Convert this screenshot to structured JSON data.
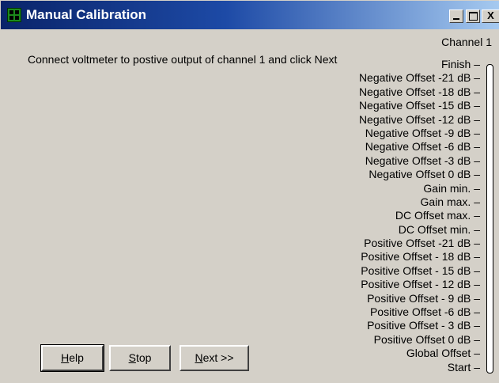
{
  "window": {
    "title": "Manual Calibration",
    "minimize_icon": "minimize-icon",
    "maximize_icon": "maximize-icon",
    "close_icon": "close-icon",
    "close_label": "X"
  },
  "channel_label": "Channel 1",
  "instruction": "Connect voltmeter to postive output of channel 1 and click Next",
  "steps": [
    "Finish",
    "Negative Offset -21 dB",
    "Negative Offset -18 dB",
    "Negative Offset -15 dB",
    "Negative Offset -12 dB",
    "Negative Offset -9 dB",
    "Negative Offset -6 dB",
    "Negative Offset -3 dB",
    "Negative Offset 0 dB",
    "Gain min.",
    "Gain max.",
    "DC Offset max.",
    "DC Offset min.",
    "Positive Offset -21 dB",
    "Positive Offset - 18 dB",
    "Positive Offset - 15 dB",
    "Positive Offset - 12 dB",
    "Positive Offset - 9 dB",
    "Positive Offset -6 dB",
    "Positive Offset - 3 dB",
    "Positive Offset 0 dB",
    "Global Offset",
    "Start"
  ],
  "buttons": {
    "help": {
      "mnemonic": "H",
      "rest": "elp"
    },
    "stop": {
      "mnemonic": "S",
      "rest": "top"
    },
    "next": {
      "mnemonic": "N",
      "rest": "ext >>"
    }
  }
}
